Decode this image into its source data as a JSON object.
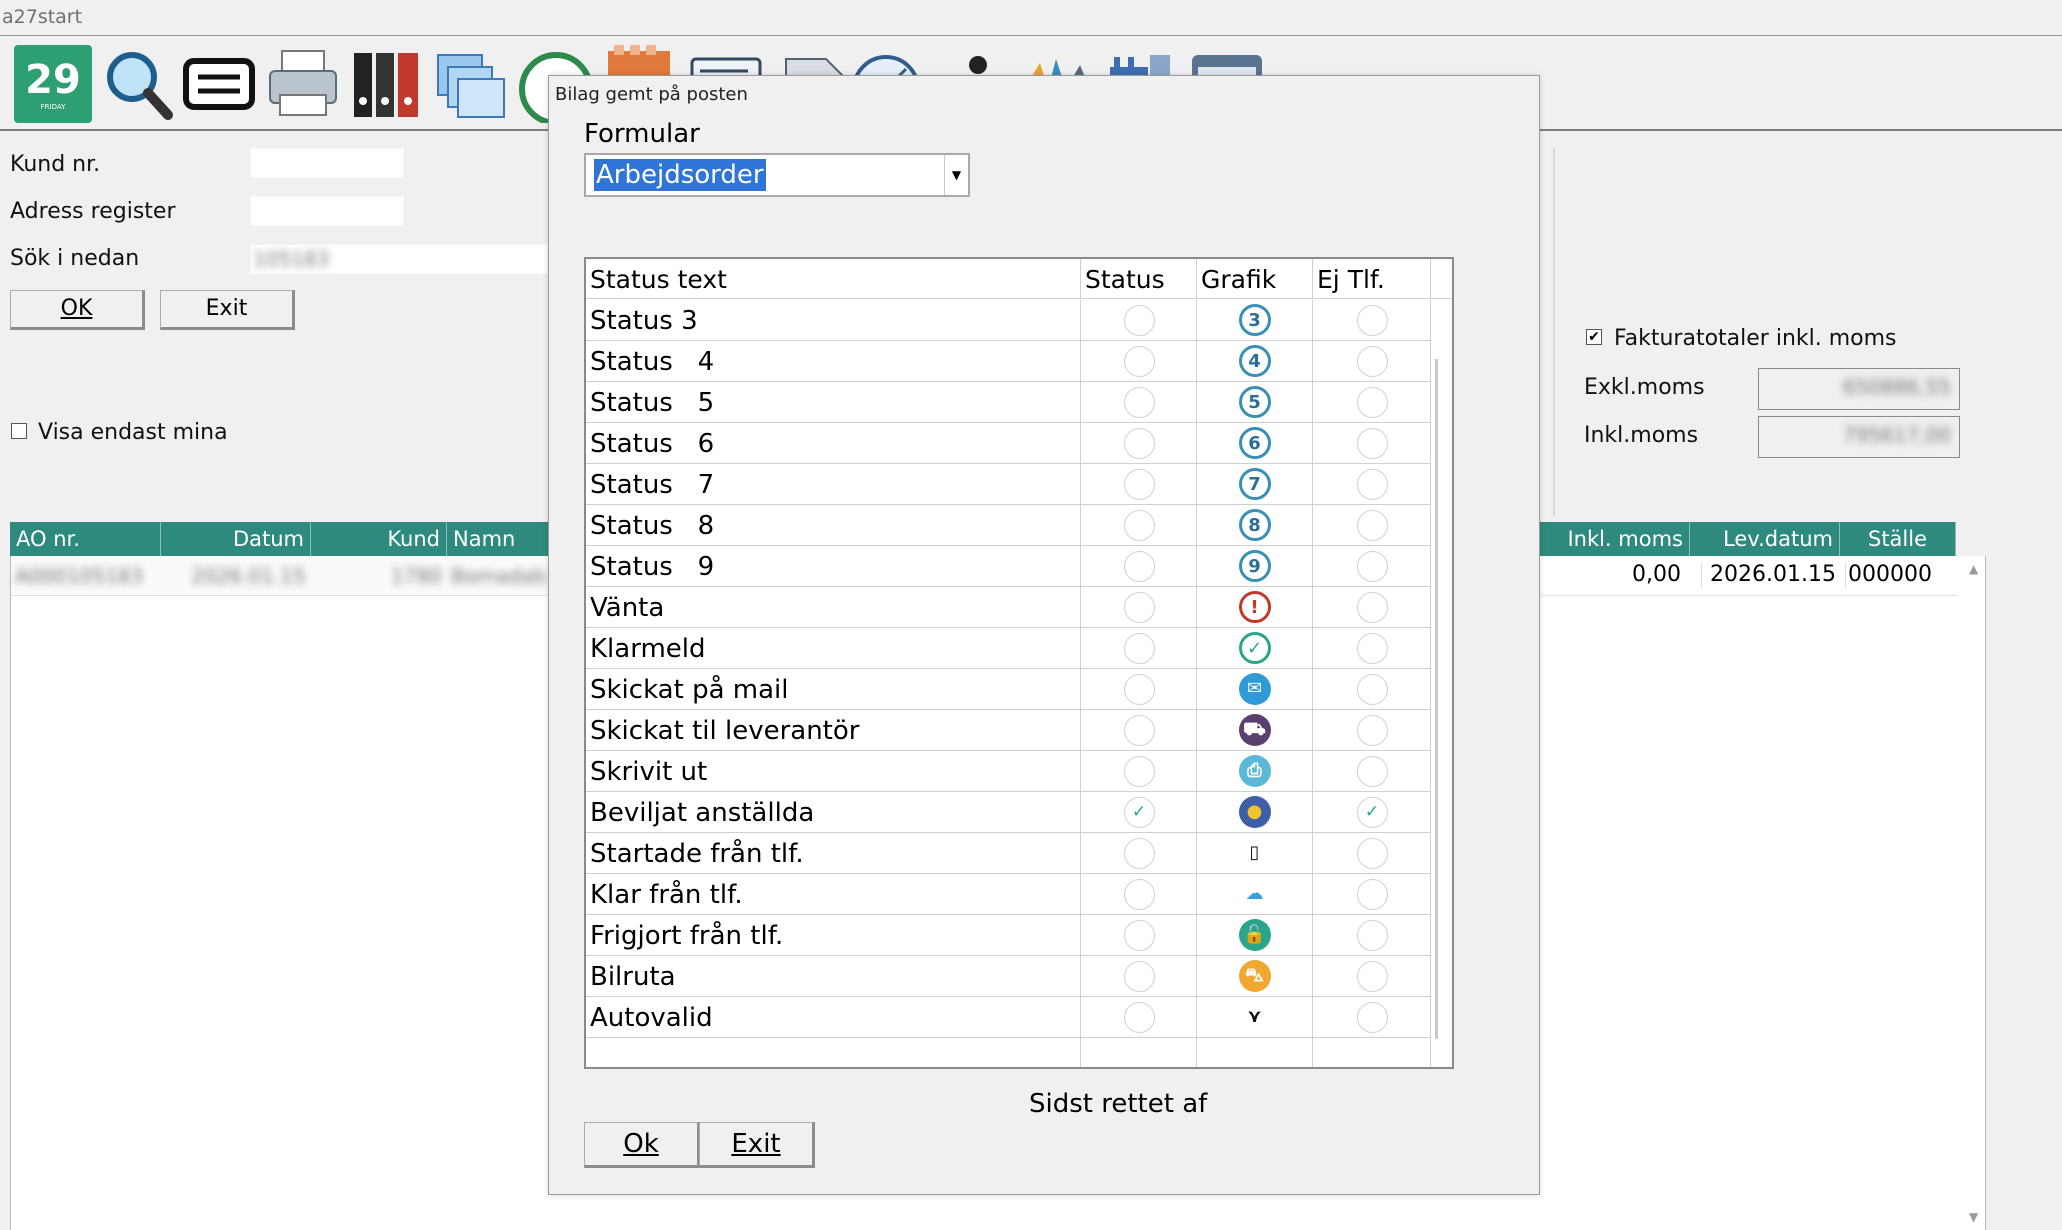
{
  "window": {
    "title": "a27start"
  },
  "toolbar": {
    "icons": [
      {
        "name": "calendar-icon",
        "text": "29",
        "sub": "FRIDAY",
        "color": "#2e9e73"
      },
      {
        "name": "search-icon"
      },
      {
        "name": "printer-receipt-icon"
      },
      {
        "name": "printer-icon"
      },
      {
        "name": "binders-icon"
      },
      {
        "name": "folders-icon"
      },
      {
        "name": "check-circle-icon"
      },
      {
        "name": "bag-icon"
      },
      {
        "name": "document-window-icon"
      },
      {
        "name": "gear-icon"
      },
      {
        "name": "clock-icon"
      },
      {
        "name": "person-icon"
      },
      {
        "name": "colorwheel-icon"
      },
      {
        "name": "factory-icon"
      },
      {
        "name": "window-icon"
      }
    ]
  },
  "search_panel": {
    "kund_label": "Kund nr.",
    "adress_label": "Adress register",
    "sok_label": "Sök i nedan",
    "sok_value": "105183",
    "ok_label": "OK",
    "exit_label": "Exit",
    "visa_label": "Visa endast mina"
  },
  "totals": {
    "checkbox_label": "Fakturatotaler inkl. moms",
    "checked": true,
    "exkl_label": "Exkl.moms",
    "exkl_value": "650886,55",
    "inkl_label": "Inkl.moms",
    "inkl_value": "795617,00"
  },
  "grid": {
    "columns": [
      "AO nr.",
      "Datum",
      "Kund",
      "Namn",
      "Inkl. moms",
      "Lev.datum",
      "Ställe"
    ],
    "row": {
      "ao": "A000105183",
      "datum": "2026.01.15",
      "kund": "1780",
      "namn": "Bomadab",
      "inkl": "0,00",
      "lev": "2026.01.15",
      "stalle": "000000"
    }
  },
  "dialog": {
    "title": "Bilag gemt på posten",
    "formular_label": "Formular",
    "formular_value": "Arbejdsorder",
    "columns": {
      "text": "Status text",
      "status": "Status",
      "grafik": "Grafik",
      "ejtlf": "Ej Tlf."
    },
    "rows": [
      {
        "text": "Status 3",
        "status": false,
        "ejtlf": false,
        "icon": "3"
      },
      {
        "text": "Status   4",
        "status": false,
        "ejtlf": false,
        "icon": "4"
      },
      {
        "text": "Status   5",
        "status": false,
        "ejtlf": false,
        "icon": "5"
      },
      {
        "text": "Status   6",
        "status": false,
        "ejtlf": false,
        "icon": "6"
      },
      {
        "text": "Status   7",
        "status": false,
        "ejtlf": false,
        "icon": "7"
      },
      {
        "text": "Status   8",
        "status": false,
        "ejtlf": false,
        "icon": "8"
      },
      {
        "text": "Status   9",
        "status": false,
        "ejtlf": false,
        "icon": "9"
      },
      {
        "text": "Vänta",
        "status": false,
        "ejtlf": false,
        "icon": "exclamation"
      },
      {
        "text": "Klarmeld",
        "status": false,
        "ejtlf": false,
        "icon": "check"
      },
      {
        "text": "Skickat på mail",
        "status": false,
        "ejtlf": false,
        "icon": "mail"
      },
      {
        "text": "Skickat til leverantör",
        "status": false,
        "ejtlf": false,
        "icon": "cart"
      },
      {
        "text": "Skrivit ut",
        "status": false,
        "ejtlf": false,
        "icon": "print"
      },
      {
        "text": "Beviljat anställda",
        "status": true,
        "ejtlf": true,
        "icon": "worker"
      },
      {
        "text": "Startade från tlf.",
        "status": false,
        "ejtlf": false,
        "icon": "phone"
      },
      {
        "text": "Klar från tlf.",
        "status": false,
        "ejtlf": false,
        "icon": "cloud"
      },
      {
        "text": "Frigjort från tlf.",
        "status": false,
        "ejtlf": false,
        "icon": "unlock"
      },
      {
        "text": "Bilruta",
        "status": false,
        "ejtlf": false,
        "icon": "car"
      },
      {
        "text": "Autovalid",
        "status": false,
        "ejtlf": false,
        "icon": "autovalid"
      }
    ],
    "sidst_label": "Sidst rettet af",
    "ok_label": "Ok",
    "exit_label": "Exit"
  }
}
